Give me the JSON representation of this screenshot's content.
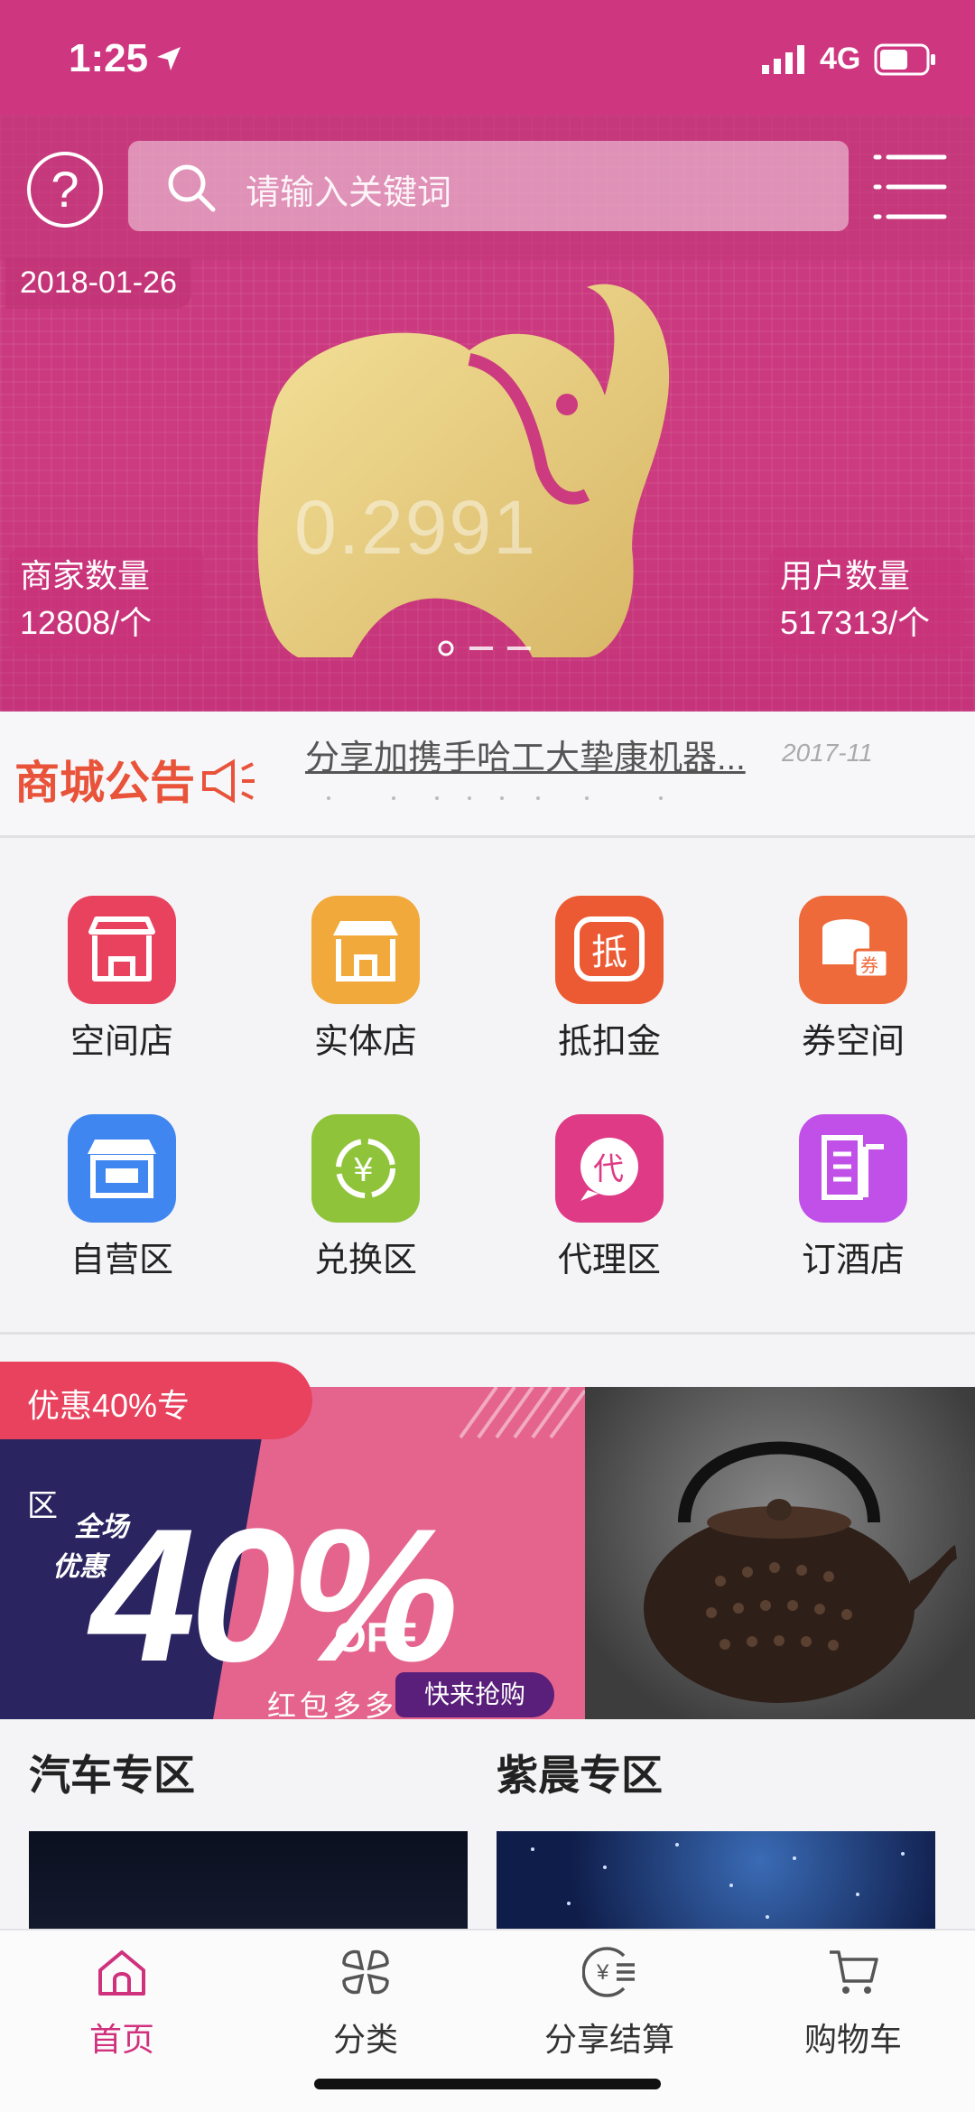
{
  "status_bar": {
    "time": "1:25",
    "network": "4G"
  },
  "header": {
    "help_icon": "question-circle-icon",
    "search_placeholder": "请输入关键词",
    "menu_icon": "hamburger-menu-icon"
  },
  "hero": {
    "date": "2018-01-26",
    "price": "0.2991",
    "merchant_label": "商家数量",
    "merchant_value": "12808/个",
    "user_label": "用户数量",
    "user_value": "517313/个",
    "slides": 3,
    "active_slide": 1
  },
  "notice": {
    "logo_text": "商城公告",
    "title": "分享加携手哈工大挚康机器...",
    "date": "2017-11"
  },
  "categories": [
    {
      "label": "空间店",
      "icon": "store-icon",
      "color": "#e8425f"
    },
    {
      "label": "实体店",
      "icon": "shop-awning-icon",
      "color": "#f0a93a"
    },
    {
      "label": "抵扣金",
      "icon": "deduct-voucher-icon",
      "color": "#ec5a33"
    },
    {
      "label": "券空间",
      "icon": "coupon-coins-icon",
      "color": "#ee6a3a"
    },
    {
      "label": "自营区",
      "icon": "self-store-icon",
      "color": "#3f86f0"
    },
    {
      "label": "兑换区",
      "icon": "exchange-yuan-icon",
      "color": "#8fc43a"
    },
    {
      "label": "代理区",
      "icon": "agent-chat-icon",
      "color": "#df3a86"
    },
    {
      "label": "订酒店",
      "icon": "hotel-building-icon",
      "color": "#c050e8"
    }
  ],
  "promo": {
    "tag": "优惠40%专",
    "tag_cont": "区",
    "badge_line1": "全场",
    "badge_line2": "优惠",
    "big_number": "40%",
    "off": "OFF",
    "redpacket": "红包多多",
    "cta": "快来抢购"
  },
  "zones": [
    {
      "title": "汽车专区"
    },
    {
      "title": "紫晨专区"
    }
  ],
  "tabbar": [
    {
      "label": "首页",
      "icon": "home-icon",
      "active": true
    },
    {
      "label": "分类",
      "icon": "category-grid-icon",
      "active": false
    },
    {
      "label": "分享结算",
      "icon": "yuan-settle-icon",
      "active": false
    },
    {
      "label": "购物车",
      "icon": "cart-icon",
      "active": false
    }
  ],
  "colors": {
    "brand": "#cf3680",
    "accent": "#d0317d"
  }
}
